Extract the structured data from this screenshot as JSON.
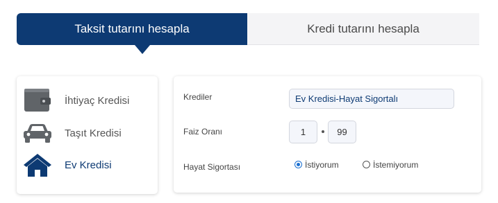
{
  "tabs": {
    "active_label": "Taksit tutarını hesapla",
    "inactive_label": "Kredi tutarını hesapla"
  },
  "loan_types": [
    {
      "label": "İhtiyaç Kredisi",
      "icon": "wallet-icon"
    },
    {
      "label": "Taşıt Kredisi",
      "icon": "car-icon"
    },
    {
      "label": "Ev Kredisi",
      "icon": "house-icon"
    }
  ],
  "form": {
    "credits_label": "Krediler",
    "credit_value": "Ev Kredisi-Hayat Sigortalı",
    "rate_label": "Faiz Oranı",
    "rate_whole": "1",
    "rate_decimal": "99",
    "insurance_label": "Hayat Sigortası",
    "insurance_yes": "İstiyorum",
    "insurance_no": "İstemiyorum",
    "insurance_selected": "yes"
  },
  "colors": {
    "accent": "#0d3a73",
    "icon_gray": "#606468",
    "radio_blue": "#1a6fd1"
  }
}
